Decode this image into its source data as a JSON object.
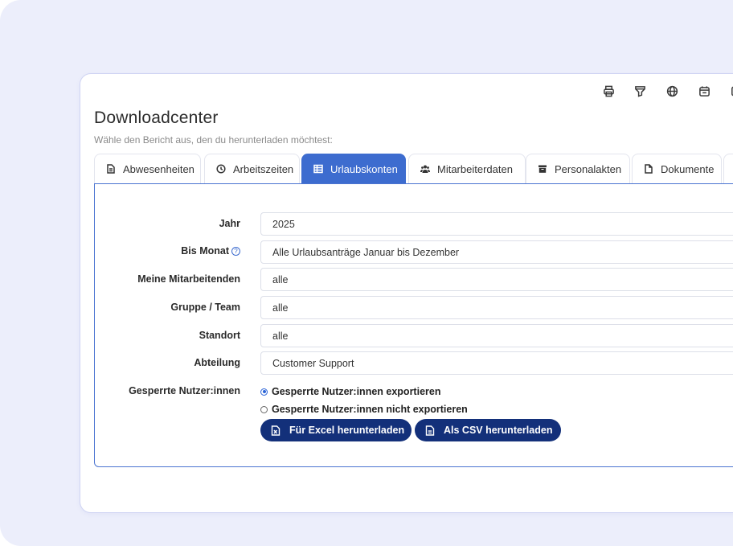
{
  "toolbar": {
    "icons": [
      "print-icon",
      "funnel-icon",
      "globe-icon",
      "calendar-icon",
      "more-icon"
    ]
  },
  "header": {
    "title": "Downloadcenter",
    "subtitle": "Wähle den Bericht aus, den du herunterladen möchtest:"
  },
  "tabs": [
    {
      "label": "Abwesenheiten",
      "icon": "document-icon"
    },
    {
      "label": "Arbeitszeiten",
      "icon": "clock-icon"
    },
    {
      "label": "Urlaubskonten",
      "icon": "table-icon",
      "active": true
    },
    {
      "label": "Mitarbeiterdaten",
      "icon": "users-icon"
    },
    {
      "label": "Personalakten",
      "icon": "archive-icon"
    },
    {
      "label": "Dokumente",
      "icon": "file-icon"
    }
  ],
  "form": {
    "year_label": "Jahr",
    "year_value": "2025",
    "month_label": "Bis Monat",
    "month_help": "?",
    "month_value": "Alle Urlaubsanträge Januar bis Dezember",
    "employees_label": "Meine Mitarbeitenden",
    "employees_value": "alle",
    "group_label": "Gruppe / Team",
    "group_value": "alle",
    "location_label": "Standort",
    "location_value": "alle",
    "department_label": "Abteilung",
    "department_value": "Customer Support",
    "blocked_label": "Gesperrte Nutzer:innen",
    "blocked_option_export": "Gesperrte Nutzer:innen exportieren",
    "blocked_option_no_export": "Gesperrte Nutzer:innen nicht exportieren",
    "blocked_selected": "export"
  },
  "actions": {
    "excel_label": "Für Excel herunterladen",
    "csv_label": "Als CSV herunterladen"
  },
  "colors": {
    "accent": "#3d6ccf",
    "button": "#13307a",
    "background": "#eceefb"
  }
}
